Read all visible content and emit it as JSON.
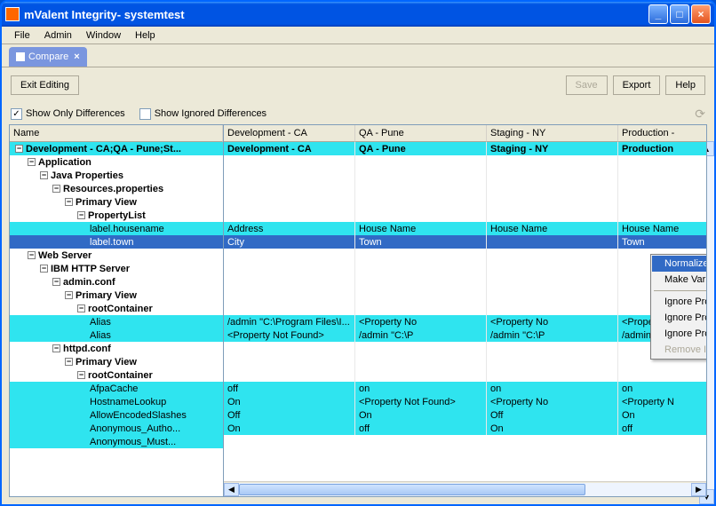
{
  "window": {
    "title": "mValent Integrity- systemtest"
  },
  "menu": {
    "items": [
      "File",
      "Admin",
      "Window",
      "Help"
    ]
  },
  "tab": {
    "label": "Compare",
    "close": "×"
  },
  "toolbar": {
    "exit_editing": "Exit Editing",
    "save": "Save",
    "export": "Export",
    "help": "Help"
  },
  "filters": {
    "show_only_diff": "Show Only Differences",
    "show_ignored": "Show Ignored Differences"
  },
  "tree_header": "Name",
  "tree": [
    {
      "label": "Development - CA;QA - Pune;St...",
      "indent": 0,
      "exp": "-",
      "hl": true
    },
    {
      "label": "Application",
      "indent": 1,
      "exp": "-",
      "hl": false
    },
    {
      "label": "Java Properties",
      "indent": 2,
      "exp": "-",
      "hl": false
    },
    {
      "label": "Resources.properties",
      "indent": 3,
      "exp": "-",
      "hl": false
    },
    {
      "label": "Primary View",
      "indent": 4,
      "exp": "-",
      "hl": false
    },
    {
      "label": "PropertyList",
      "indent": 5,
      "exp": "-",
      "hl": false
    },
    {
      "label": "label.housename",
      "indent": 6,
      "exp": "",
      "hl": true
    },
    {
      "label": "label.town",
      "indent": 6,
      "exp": "",
      "hl": true,
      "sel": true
    },
    {
      "label": "Web Server",
      "indent": 1,
      "exp": "-",
      "hl": false
    },
    {
      "label": "IBM HTTP Server",
      "indent": 2,
      "exp": "-",
      "hl": false
    },
    {
      "label": "admin.conf",
      "indent": 3,
      "exp": "-",
      "hl": false
    },
    {
      "label": "Primary View",
      "indent": 4,
      "exp": "-",
      "hl": false
    },
    {
      "label": "rootContainer",
      "indent": 5,
      "exp": "-",
      "hl": false
    },
    {
      "label": "Alias",
      "indent": 6,
      "exp": "",
      "hl": true
    },
    {
      "label": "Alias",
      "indent": 6,
      "exp": "",
      "hl": true
    },
    {
      "label": "httpd.conf",
      "indent": 3,
      "exp": "-",
      "hl": false
    },
    {
      "label": "Primary View",
      "indent": 4,
      "exp": "-",
      "hl": false
    },
    {
      "label": "rootContainer",
      "indent": 5,
      "exp": "-",
      "hl": false
    },
    {
      "label": "AfpaCache",
      "indent": 6,
      "exp": "",
      "hl": true
    },
    {
      "label": "HostnameLookup",
      "indent": 6,
      "exp": "",
      "hl": true
    },
    {
      "label": "AllowEncodedSlashes",
      "indent": 6,
      "exp": "",
      "hl": true
    },
    {
      "label": "Anonymous_Autho...",
      "indent": 6,
      "exp": "",
      "hl": true
    },
    {
      "label": "Anonymous_Must...",
      "indent": 6,
      "exp": "",
      "hl": true
    }
  ],
  "grid": {
    "headers": [
      "Development - CA",
      "QA - Pune",
      "Staging - NY",
      "Production -"
    ],
    "rows": [
      {
        "cells": [
          "Development - CA",
          "QA - Pune",
          "Staging - NY",
          "Production"
        ],
        "hl": true,
        "bold": true
      },
      {
        "cells": [
          "",
          "",
          "",
          ""
        ],
        "hl": false
      },
      {
        "cells": [
          "",
          "",
          "",
          ""
        ],
        "hl": false
      },
      {
        "cells": [
          "",
          "",
          "",
          ""
        ],
        "hl": false
      },
      {
        "cells": [
          "",
          "",
          "",
          ""
        ],
        "hl": false
      },
      {
        "cells": [
          "",
          "",
          "",
          ""
        ],
        "hl": false
      },
      {
        "cells": [
          "Address",
          "House Name",
          "House Name",
          "House Name"
        ],
        "hl": true
      },
      {
        "cells": [
          "City",
          "Town",
          "",
          "Town"
        ],
        "sel": true
      },
      {
        "cells": [
          "",
          "",
          "",
          ""
        ],
        "hl": false
      },
      {
        "cells": [
          "",
          "",
          "",
          ""
        ],
        "hl": false
      },
      {
        "cells": [
          "",
          "",
          "",
          ""
        ],
        "hl": false
      },
      {
        "cells": [
          "",
          "",
          "",
          ""
        ],
        "hl": false
      },
      {
        "cells": [
          "",
          "",
          "",
          ""
        ],
        "hl": false
      },
      {
        "cells": [
          "/admin \"C:\\Program Files\\I...",
          "<Property No",
          "<Property No",
          "<Property No"
        ],
        "hl": true
      },
      {
        "cells": [
          "<Property Not Found>",
          "/admin \"C:\\P",
          "/admin \"C:\\P",
          "/admin \"C:\\P"
        ],
        "hl": true
      },
      {
        "cells": [
          "",
          "",
          "",
          ""
        ],
        "hl": false
      },
      {
        "cells": [
          "",
          "",
          "",
          ""
        ],
        "hl": false
      },
      {
        "cells": [
          "",
          "",
          "",
          ""
        ],
        "hl": false
      },
      {
        "cells": [
          "off",
          "on",
          "on",
          "on"
        ],
        "hl": true
      },
      {
        "cells": [
          "On",
          "<Property Not Found>",
          "<Property No",
          "<Property N"
        ],
        "hl": true
      },
      {
        "cells": [
          "Off",
          "On",
          "Off",
          "On"
        ],
        "hl": true
      },
      {
        "cells": [
          "On",
          "off",
          "On",
          "off"
        ],
        "hl": true
      }
    ]
  },
  "context_menu": {
    "items": [
      {
        "label": "Normalize Property Row...",
        "highlight": true
      },
      {
        "label": "Make Variable...",
        "highlight": false
      },
      {
        "sep": true
      },
      {
        "label": "Ignore Property (At Configuration Level)",
        "highlight": false
      },
      {
        "label": "Ignore Property (At Asset Level)",
        "highlight": false
      },
      {
        "label": "Ignore Property For This Session",
        "highlight": false
      },
      {
        "label": "Remove Ignored Property",
        "disabled": true
      }
    ]
  }
}
